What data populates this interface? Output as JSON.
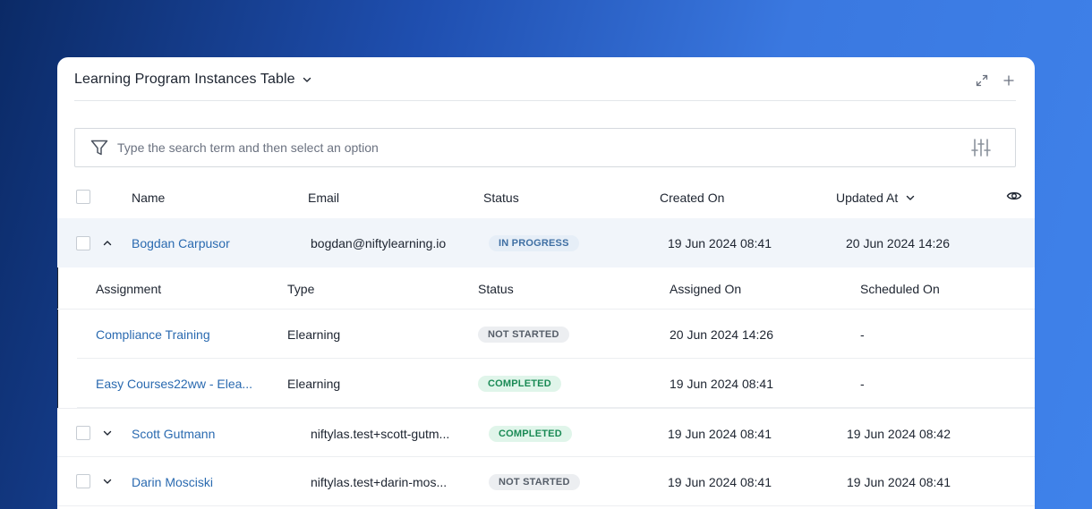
{
  "header": {
    "title": "Learning Program Instances Table"
  },
  "search": {
    "placeholder": "Type the search term and then select an option"
  },
  "columns": {
    "name": "Name",
    "email": "Email",
    "status": "Status",
    "created_on": "Created On",
    "updated_at": "Updated At"
  },
  "rows": [
    {
      "name": "Bogdan Carpusor",
      "email": "bogdan@niftylearning.io",
      "status": "IN PROGRESS",
      "created_on": "19 Jun 2024 08:41",
      "updated_at": "20 Jun 2024 14:26"
    },
    {
      "name": "Scott Gutmann",
      "email": "niftylas.test+scott-gutm...",
      "status": "COMPLETED",
      "created_on": "19 Jun 2024 08:41",
      "updated_at": "19 Jun 2024 08:42"
    },
    {
      "name": "Darin Mosciski",
      "email": "niftylas.test+darin-mos...",
      "status": "NOT STARTED",
      "created_on": "19 Jun 2024 08:41",
      "updated_at": "19 Jun 2024 08:41"
    }
  ],
  "subtable": {
    "columns": {
      "assignment": "Assignment",
      "type": "Type",
      "status": "Status",
      "assigned_on": "Assigned On",
      "scheduled_on": "Scheduled On"
    },
    "rows": [
      {
        "assignment": "Compliance Training",
        "type": "Elearning",
        "status": "NOT STARTED",
        "assigned_on": "20 Jun 2024 14:26",
        "scheduled_on": "-"
      },
      {
        "assignment": "Easy Courses22ww - Elea...",
        "type": "Elearning",
        "status": "COMPLETED",
        "assigned_on": "19 Jun 2024 08:41",
        "scheduled_on": "-"
      }
    ]
  },
  "icons": {
    "title_caret": "chevron-down-icon",
    "expand": "expand-icon",
    "add": "plus-icon",
    "filter": "filter-icon",
    "settings": "sliders-icon",
    "sort": "chevron-down-icon",
    "visibility": "eye-icon"
  },
  "colors": {
    "link": "#2a6ab0",
    "in_progress_bg": "#e6eef7",
    "completed_bg": "#e0f5ea",
    "not_started_bg": "#eceef1"
  }
}
